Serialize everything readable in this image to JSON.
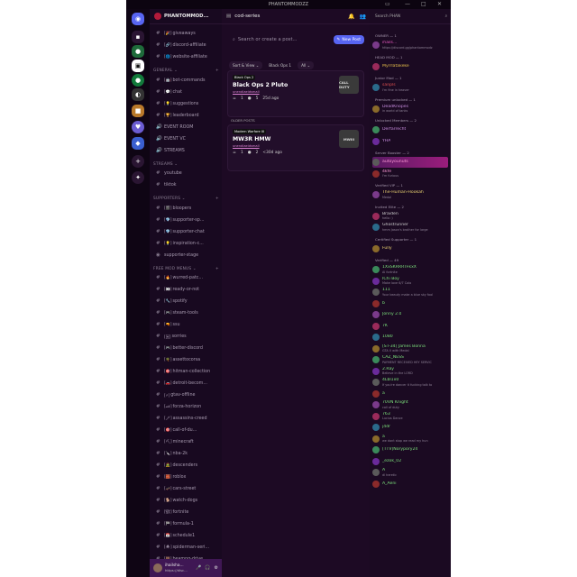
{
  "window": {
    "title": "PHANTOMMODZZ"
  },
  "server": {
    "name": "PHANTOMMOD..."
  },
  "channel_header": {
    "name": "cod-series"
  },
  "forum": {
    "search_placeholder": "Search or create a post...",
    "new_post_label": "New Post",
    "sort_label": "Sort & View",
    "filter_tag": "Black Ops 1",
    "filter_all": "All",
    "older_label": "OLDER POSTS",
    "posts": [
      {
        "tag": "Black Ops 2",
        "title": "Black Ops 2 Pluto",
        "author": "unendlaeidsmall",
        "reactions": "1",
        "comments": "5",
        "age": "25d ago",
        "thumb": "CALL DUTY"
      },
      {
        "tag": "Modern Warfare III",
        "title": "MW3R HMW",
        "author": "unendlaeidsmall",
        "reactions": "1",
        "comments": "2",
        "age": "<30d ago",
        "thumb": "MWIII"
      }
    ]
  },
  "channels": {
    "top": [
      {
        "emoji": "[🎉]",
        "name": "giveaways"
      },
      {
        "emoji": "[🔗]",
        "name": "discord-affiliate"
      },
      {
        "emoji": "[🌐]",
        "name": "website-affiliate"
      }
    ],
    "general_label": "GENERAL",
    "general": [
      {
        "emoji": "[🤖]",
        "name": "bot-commands"
      },
      {
        "emoji": "[💬]",
        "name": "chat"
      },
      {
        "emoji": "[💡]",
        "name": "suggestions"
      },
      {
        "emoji": "[🏆]",
        "name": "leaderboard"
      },
      {
        "emoji": "",
        "name": "EVENT ROOM"
      },
      {
        "emoji": "",
        "name": "EVENT VC"
      },
      {
        "emoji": "",
        "name": "STREAMS"
      }
    ],
    "streams_label": "STREAMS",
    "streams": [
      {
        "emoji": "",
        "name": "youtube"
      },
      {
        "emoji": "",
        "name": "tiktok"
      }
    ],
    "supporters_label": "SUPPORTERS",
    "supporters": [
      {
        "emoji": "[🎬]",
        "name": "bloopers"
      },
      {
        "emoji": "[💎]",
        "name": "supporter-sp..."
      },
      {
        "emoji": "[💎]",
        "name": "supporter-chat"
      },
      {
        "emoji": "[💡]",
        "name": "inspiration-c..."
      },
      {
        "emoji": "",
        "name": "supporter-stage"
      }
    ],
    "free_label": "FREE MOD MENUS",
    "free": [
      {
        "emoji": "[🔥]",
        "name": "wurred-patc..."
      },
      {
        "emoji": "[👀]",
        "name": "ready-or-not"
      },
      {
        "emoji": "[🔧]",
        "name": "spotify"
      },
      {
        "emoji": "[🎮]",
        "name": "steam-tools"
      },
      {
        "emoji": "[🔫]",
        "name": "ssu"
      },
      {
        "emoji": "[🃏]",
        "name": "sorries"
      },
      {
        "emoji": "[🎮]",
        "name": "better-discord"
      },
      {
        "emoji": "[🌴]",
        "name": "assettocorsa"
      },
      {
        "emoji": "[🎯]",
        "name": "hitman-collection"
      },
      {
        "emoji": "[🚗]",
        "name": "detroit-becom..."
      },
      {
        "emoji": "[⚡]",
        "name": "gtav-offline"
      },
      {
        "emoji": "[🏎]",
        "name": "forza-horizon"
      },
      {
        "emoji": "[🗡]",
        "name": "assassins-creed"
      },
      {
        "emoji": "[🎯]",
        "name": "call-of-du..."
      },
      {
        "emoji": "[⛏]",
        "name": "minecraft"
      },
      {
        "emoji": "[🔪]",
        "name": "nba-2k"
      },
      {
        "emoji": "[🧟]",
        "name": "descenders"
      },
      {
        "emoji": "[🧱]",
        "name": "roblox"
      },
      {
        "emoji": "[🛹]",
        "name": "cars-street"
      },
      {
        "emoji": "[🐕]",
        "name": "watch-dogs"
      },
      {
        "emoji": "[🏗]",
        "name": "fortnite"
      },
      {
        "emoji": "[🏁]",
        "name": "formula-1"
      },
      {
        "emoji": "[📅]",
        "name": "schedule1"
      },
      {
        "emoji": "[🕷]",
        "name": "spiderman-seri..."
      },
      {
        "emoji": "[🐻]",
        "name": "beamng-drive"
      }
    ]
  },
  "user": {
    "name": "ihailsha...",
    "status": "https://disc..."
  },
  "member_search": {
    "placeholder": "Search PHAN"
  },
  "member_groups": [
    {
      "label": "OWNER — 1",
      "members": [
        {
          "name": "ihails...",
          "sub": "https://discord.gg/phantommodz",
          "color": "#e85ac0"
        }
      ]
    },
    {
      "label": "HEAD MOD — 1",
      "members": [
        {
          "name": "Myrrlatakeke",
          "sub": "",
          "color": "#e8c04a"
        }
      ]
    },
    {
      "label": "Junior Mod — 1",
      "members": [
        {
          "name": "sanpls",
          "sub": "I'm fine in heaven",
          "color": "#e05050"
        }
      ]
    },
    {
      "label": "Premium unlocked — 1",
      "members": [
        {
          "name": "DeadKnopes",
          "sub": "in world of tanks",
          "color": "#c98de0"
        }
      ]
    },
    {
      "label": "Unlocked Members — 2",
      "members": [
        {
          "name": "Derfarrecht",
          "sub": "",
          "color": "#c98de0"
        },
        {
          "name": "YHA",
          "sub": "",
          "color": "#c98de0"
        }
      ]
    },
    {
      "label": "Server Booster — 2",
      "members": [
        {
          "name": "autoyounuts",
          "sub": "",
          "color": "#ff9ad8"
        },
        {
          "name": "4kfe",
          "sub": "I'm furious",
          "color": "#ff9ad8"
        }
      ]
    },
    {
      "label": "Verified VIP — 1",
      "members": [
        {
          "name": "The-Human-Hookah",
          "sub": "Medal",
          "color": "#e8d070"
        }
      ]
    },
    {
      "label": "Invited Elite — 2",
      "members": [
        {
          "name": "Braiden",
          "sub": "hello :)",
          "color": "#d0d0d0"
        },
        {
          "name": "Ghostrunner",
          "sub": "hmm Jason's brother for large",
          "color": "#d0d0d0"
        }
      ]
    },
    {
      "label": "Certified Supporter — 1",
      "members": [
        {
          "name": "Fully",
          "sub": "",
          "color": "#e8d070"
        }
      ]
    },
    {
      "label": "Verified — 49",
      "members": [
        {
          "name": "1XxSKRRRTFkxX",
          "sub": "Al fortnite",
          "color": "#7be07b"
        },
        {
          "name": "IChi Boy",
          "sub": "Make love 6/7 Colo",
          "color": "#7be07b"
        },
        {
          "name": "111",
          "sub": "Your beauty make a blue sky fool",
          "color": "#7be07b"
        },
        {
          "name": "b",
          "sub": "",
          "color": "#7be07b"
        },
        {
          "name": "Jonny 2.0",
          "sub": "",
          "color": "#7be07b"
        },
        {
          "name": "7K",
          "sub": "",
          "color": "#7be07b"
        },
        {
          "name": "1080",
          "sub": "",
          "color": "#7be07b"
        },
        {
          "name": "[ST-34] James Bonna",
          "sub": "GTA V with Medal",
          "color": "#7be07b"
        },
        {
          "name": "CAZ_NESS",
          "sub": "PAYMENT RECEIVED HEY SERVIC",
          "color": "#7be07b"
        },
        {
          "name": "2.Ray",
          "sub": "Believe in the LORD",
          "color": "#7be07b"
        },
        {
          "name": "4Lbl1x0",
          "sub": "If you're dancer it fucking talk to",
          "color": "#7be07b"
        },
        {
          "name": "a",
          "sub": "",
          "color": "#7be07b"
        },
        {
          "name": "70VN Knight",
          "sub": "call of duty",
          "color": "#7be07b"
        },
        {
          "name": "763",
          "sub": "Lucius Dance",
          "color": "#7be07b"
        },
        {
          "name": "j4dr",
          "sub": "",
          "color": "#7be07b"
        },
        {
          "name": "a",
          "sub": "we dont stop we read my hun",
          "color": "#7be07b"
        },
        {
          "name": "[TTV]Norypory24",
          "sub": "",
          "color": "#7be07b"
        },
        {
          "name": "_ezok_02",
          "sub": "",
          "color": "#7be07b"
        },
        {
          "name": "A",
          "sub": "dl heretic",
          "color": "#7be07b"
        },
        {
          "name": "A_Aeni",
          "sub": "",
          "color": "#7be07b"
        }
      ]
    }
  ],
  "colors": {
    "accent": "#5865f2",
    "bg": "#1c0b22",
    "sidebar": "#180920",
    "member_green": "#7be07b"
  }
}
